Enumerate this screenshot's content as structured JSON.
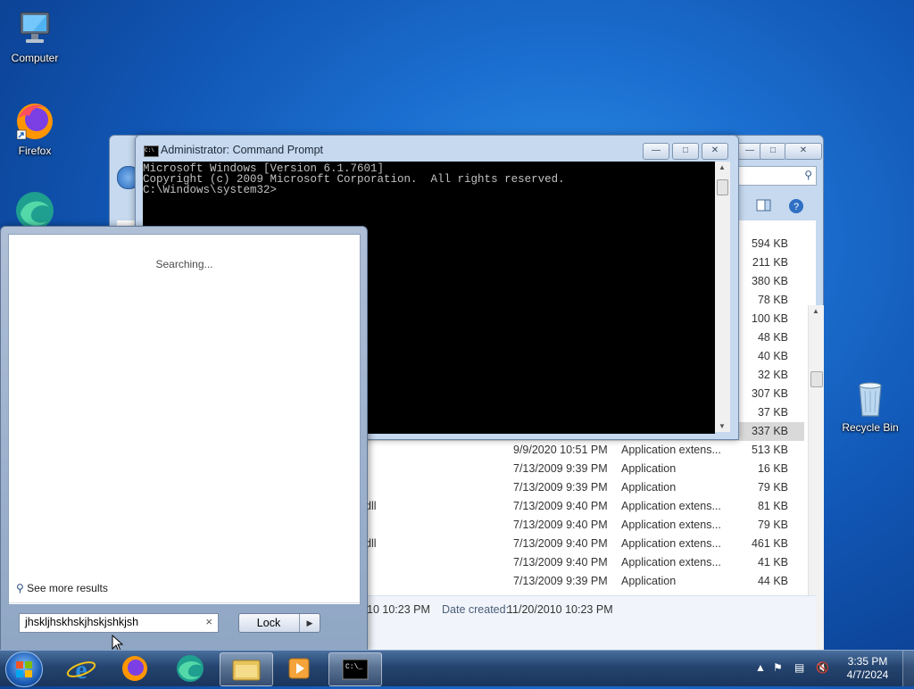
{
  "desktop": {
    "icons": [
      {
        "label": "Computer"
      },
      {
        "label": "Firefox"
      },
      {
        "label": "Recycle Bin"
      }
    ]
  },
  "cmd": {
    "title": "Administrator: Command Prompt",
    "lines": [
      "Microsoft Windows [Version 6.1.7601]",
      "Copyright (c) 2009 Microsoft Corporation.  All rights reserved.",
      "",
      "C:\\Windows\\system32>"
    ]
  },
  "explorer": {
    "sizes": [
      "594 KB",
      "211 KB",
      "380 KB",
      "78 KB",
      "100 KB",
      "48 KB",
      "40 KB",
      "32 KB",
      "307 KB",
      "37 KB",
      "337 KB"
    ],
    "rows": [
      {
        "name": "",
        "date": "9/9/2020 10:51 PM",
        "type": "Application extens...",
        "size": "513 KB"
      },
      {
        "name": "",
        "date": "7/13/2009 9:39 PM",
        "type": "Application",
        "size": "16 KB"
      },
      {
        "name": "",
        "date": "7/13/2009 9:39 PM",
        "type": "Application",
        "size": "79 KB"
      },
      {
        "name": "dll",
        "date": "7/13/2009 9:40 PM",
        "type": "Application extens...",
        "size": "81 KB"
      },
      {
        "name": "",
        "date": "7/13/2009 9:40 PM",
        "type": "Application extens...",
        "size": "79 KB"
      },
      {
        "name": "dll",
        "date": "7/13/2009 9:40 PM",
        "type": "Application extens...",
        "size": "461 KB"
      },
      {
        "name": "",
        "date": "7/13/2009 9:40 PM",
        "type": "Application extens...",
        "size": "41 KB"
      },
      {
        "name": "",
        "date": "7/13/2009 9:39 PM",
        "type": "Application",
        "size": "44 KB"
      }
    ],
    "status": {
      "modified_value": "10 10:23 PM",
      "created_label": "Date created:",
      "created_value": "11/20/2010 10:23 PM"
    }
  },
  "startmenu": {
    "searching": "Searching...",
    "see_more": "See more results",
    "search_value": "jhskljhskhskjhskjshkjsh",
    "lock_label": "Lock"
  },
  "taskbar": {
    "time": "3:35 PM",
    "date": "4/7/2024"
  },
  "colors": {
    "accent": "#1b6fd0",
    "console_bg": "#000000",
    "console_fg": "#c0c0c0"
  }
}
